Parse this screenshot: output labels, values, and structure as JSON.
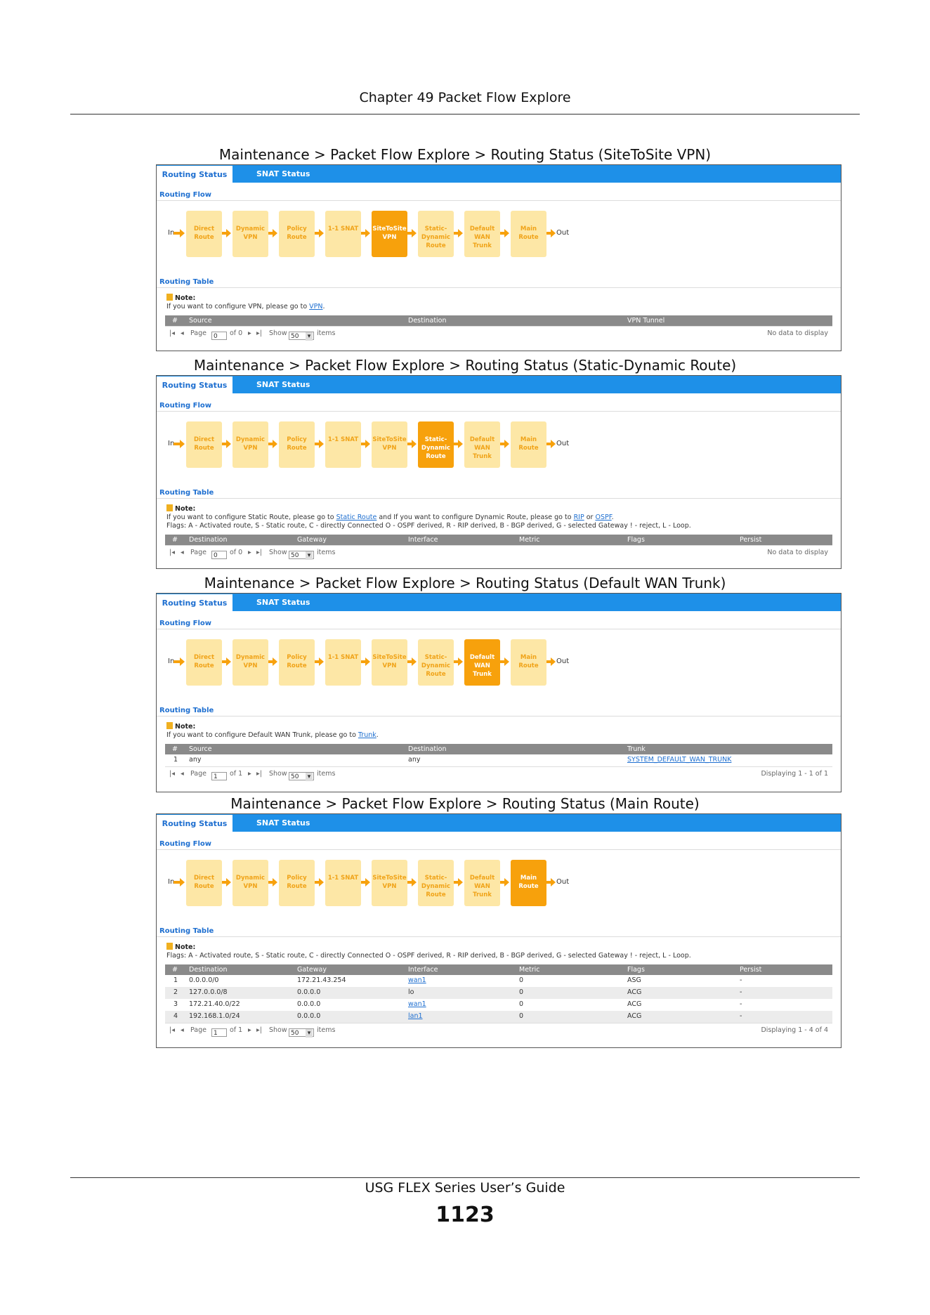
{
  "header": {
    "chapter": "Chapter 49 Packet Flow Explore"
  },
  "footer": {
    "guide": "USG FLEX Series User’s Guide",
    "page": "1123"
  },
  "tabs": {
    "active": "Routing Status",
    "inactive": "SNAT Status"
  },
  "sections": {
    "flow": "Routing Flow",
    "table": "Routing Table"
  },
  "flow": {
    "in": "In",
    "out": "Out",
    "boxes": [
      "Direct Route",
      "Dynamic VPN",
      "Policy Route",
      "1-1 SNAT",
      "SiteToSite VPN",
      "Static-Dynamic Route",
      "Default WAN Trunk",
      "Main Route"
    ]
  },
  "common": {
    "note_title": "Note:",
    "page_label": "Page",
    "show_label": "Show",
    "items_label": "items",
    "show_value": "50"
  },
  "screens": [
    {
      "caption": "Maintenance > Packet Flow Explore > Routing Status (SiteToSite VPN)",
      "active_box": 4,
      "note_pre": "If you want to configure VPN, please go to ",
      "note_link": "VPN",
      "note_post": ".",
      "cols": [
        "#",
        "Source",
        "Destination",
        "VPN Tunnel"
      ],
      "page_value": "0",
      "of_label": "of 0",
      "status": "No data to display"
    },
    {
      "caption": "Maintenance > Packet Flow Explore > Routing Status (Static-Dynamic Route)",
      "active_box": 5,
      "note_a": "If you want to configure Static Route, please go to ",
      "link1": "Static Route",
      "note_b": " and If you want to configure Dynamic Route, please go to ",
      "link2": "RIP",
      "note_c": " or ",
      "link3": "OSPF",
      "note_d": ".",
      "flags": "Flags: A - Activated route, S - Static route, C - directly Connected O - OSPF derived, R - RIP derived, B - BGP derived, G - selected Gateway ! - reject, L - Loop.",
      "cols": [
        "#",
        "Destination",
        "Gateway",
        "Interface",
        "Metric",
        "Flags",
        "Persist"
      ],
      "page_value": "0",
      "of_label": "of 0",
      "status": "No data to display"
    },
    {
      "caption": "Maintenance > Packet Flow Explore > Routing Status (Default WAN Trunk)",
      "active_box": 6,
      "note_pre": "If you want to configure Default WAN Trunk, please go to ",
      "note_link": "Trunk",
      "note_post": ".",
      "cols": [
        "#",
        "Source",
        "Destination",
        "Trunk"
      ],
      "rows": [
        [
          "1",
          "any",
          "any",
          "SYSTEM_DEFAULT_WAN_TRUNK"
        ]
      ],
      "page_value": "1",
      "of_label": "of 1",
      "status": "Displaying 1 - 1 of 1"
    },
    {
      "caption": "Maintenance > Packet Flow Explore > Routing Status (Main Route)",
      "active_box": 7,
      "flags": "Flags: A - Activated route, S - Static route, C - directly Connected O - OSPF derived, R - RIP derived, B - BGP derived, G - selected Gateway ! - reject, L - Loop.",
      "cols": [
        "#",
        "Destination",
        "Gateway",
        "Interface",
        "Metric",
        "Flags",
        "Persist"
      ],
      "rows": [
        [
          "1",
          "0.0.0.0/0",
          "172.21.43.254",
          "wan1",
          "0",
          "ASG",
          "-"
        ],
        [
          "2",
          "127.0.0.0/8",
          "0.0.0.0",
          "lo",
          "0",
          "ACG",
          "-"
        ],
        [
          "3",
          "172.21.40.0/22",
          "0.0.0.0",
          "wan1",
          "0",
          "ACG",
          "-"
        ],
        [
          "4",
          "192.168.1.0/24",
          "0.0.0.0",
          "lan1",
          "0",
          "ACG",
          "-"
        ]
      ],
      "page_value": "1",
      "of_label": "of 1",
      "status": "Displaying 1 - 4 of 4"
    }
  ],
  "colors": {
    "tab_blue": "#1e90e8",
    "box_light": "#fde7a6",
    "box_active": "#f7a10c",
    "link": "#1e6fd0"
  }
}
